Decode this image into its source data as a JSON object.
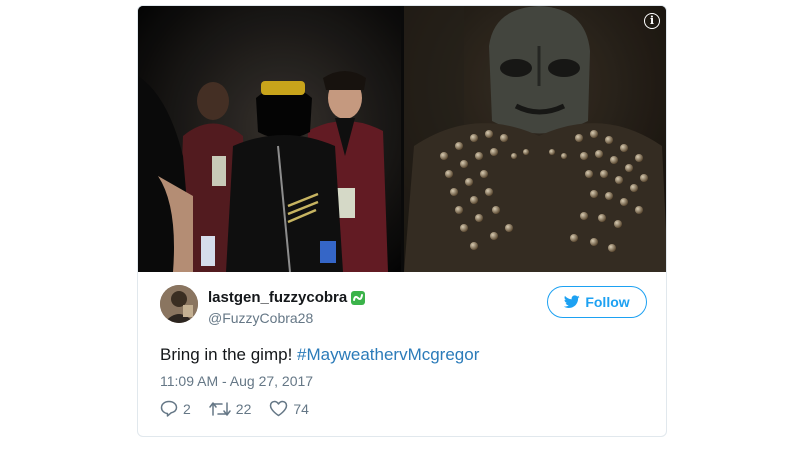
{
  "tweet": {
    "display_name": "lastgen_fuzzycobra",
    "handle": "@FuzzyCobra28",
    "follow_label": "Follow",
    "text_plain": "Bring in the gimp! ",
    "hashtag": "#MayweathervMcgregor",
    "timestamp": "11:09 AM - Aug 27, 2017",
    "replies": "2",
    "retweets": "22",
    "likes": "74"
  },
  "icons": {
    "info": "info-icon",
    "badge": "green-badge-icon",
    "follow": "bird-icon",
    "reply": "reply-icon",
    "retweet": "retweet-icon",
    "like": "heart-icon"
  },
  "colors": {
    "accent": "#1da1f2",
    "hashtag": "#2b7bb9",
    "muted": "#657786",
    "badge": "#3bb34a"
  }
}
